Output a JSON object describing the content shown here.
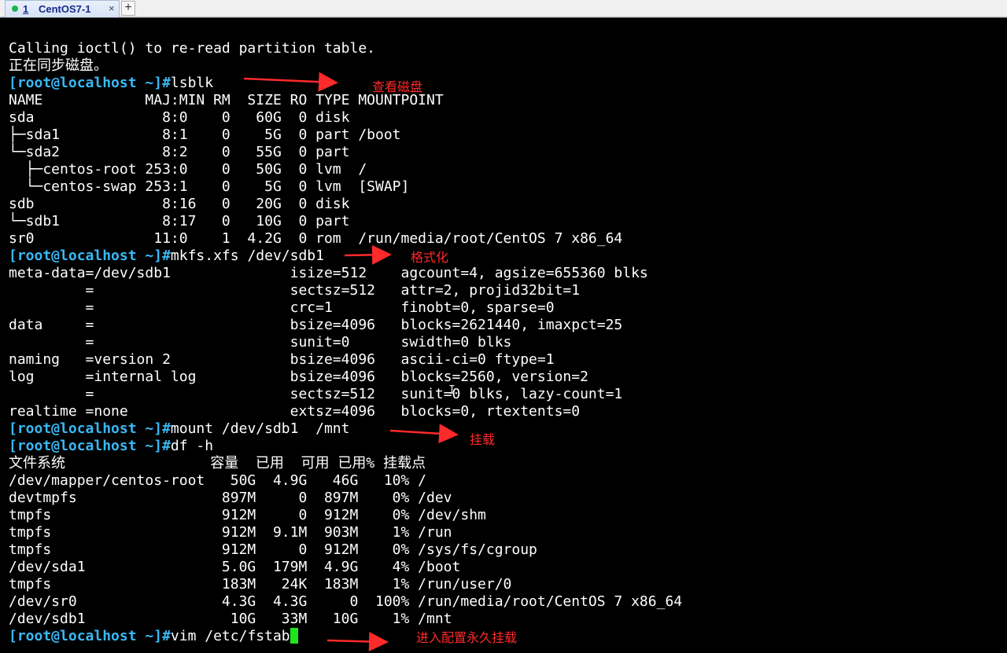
{
  "tab": {
    "number": "1",
    "title": "CentOS7-1",
    "close_glyph": "×",
    "add_glyph": "+"
  },
  "terminal": {
    "prompt": "[root@localhost ~]#",
    "lines": [
      {
        "type": "output",
        "text": "Calling ioctl() to re-read partition table."
      },
      {
        "type": "output",
        "text": "正在同步磁盘。"
      },
      {
        "type": "prompt",
        "cmd": "lsblk"
      },
      {
        "type": "output",
        "text": "NAME            MAJ:MIN RM  SIZE RO TYPE MOUNTPOINT"
      },
      {
        "type": "output",
        "text": "sda               8:0    0   60G  0 disk"
      },
      {
        "type": "output",
        "text": "├─sda1            8:1    0    5G  0 part /boot"
      },
      {
        "type": "output",
        "text": "└─sda2            8:2    0   55G  0 part"
      },
      {
        "type": "output",
        "text": "  ├─centos-root 253:0    0   50G  0 lvm  /"
      },
      {
        "type": "output",
        "text": "  └─centos-swap 253:1    0    5G  0 lvm  [SWAP]"
      },
      {
        "type": "output",
        "text": "sdb               8:16   0   20G  0 disk"
      },
      {
        "type": "output",
        "text": "└─sdb1            8:17   0   10G  0 part"
      },
      {
        "type": "output",
        "text": "sr0              11:0    1  4.2G  0 rom  /run/media/root/CentOS 7 x86_64"
      },
      {
        "type": "prompt",
        "cmd": "mkfs.xfs /dev/sdb1"
      },
      {
        "type": "output",
        "text": "meta-data=/dev/sdb1              isize=512    agcount=4, agsize=655360 blks"
      },
      {
        "type": "output",
        "text": "         =                       sectsz=512   attr=2, projid32bit=1"
      },
      {
        "type": "output",
        "text": "         =                       crc=1        finobt=0, sparse=0"
      },
      {
        "type": "output",
        "text": "data     =                       bsize=4096   blocks=2621440, imaxpct=25"
      },
      {
        "type": "output",
        "text": "         =                       sunit=0      swidth=0 blks"
      },
      {
        "type": "output",
        "text": "naming   =version 2              bsize=4096   ascii-ci=0 ftype=1"
      },
      {
        "type": "output",
        "text": "log      =internal log           bsize=4096   blocks=2560, version=2"
      },
      {
        "type": "output",
        "text": "         =                       sectsz=512   sunit=0 blks, lazy-count=1"
      },
      {
        "type": "output",
        "text": "realtime =none                   extsz=4096   blocks=0, rtextents=0"
      },
      {
        "type": "prompt",
        "cmd": "mount /dev/sdb1  /mnt"
      },
      {
        "type": "prompt",
        "cmd": "df -h"
      },
      {
        "type": "output",
        "text": "文件系统                 容量  已用  可用 已用% 挂载点"
      },
      {
        "type": "output",
        "text": "/dev/mapper/centos-root   50G  4.9G   46G   10% /"
      },
      {
        "type": "output",
        "text": "devtmpfs                 897M     0  897M    0% /dev"
      },
      {
        "type": "output",
        "text": "tmpfs                    912M     0  912M    0% /dev/shm"
      },
      {
        "type": "output",
        "text": "tmpfs                    912M  9.1M  903M    1% /run"
      },
      {
        "type": "output",
        "text": "tmpfs                    912M     0  912M    0% /sys/fs/cgroup"
      },
      {
        "type": "output",
        "text": "/dev/sda1                5.0G  179M  4.9G    4% /boot"
      },
      {
        "type": "output",
        "text": "tmpfs                    183M   24K  183M    1% /run/user/0"
      },
      {
        "type": "output",
        "text": "/dev/sr0                 4.3G  4.3G     0  100% /run/media/root/CentOS 7 x86_64"
      },
      {
        "type": "output",
        "text": "/dev/sdb1                 10G   33M   10G    1% /mnt"
      },
      {
        "type": "prompt",
        "cmd": "vim /etc/fstab",
        "cursor": true
      }
    ]
  },
  "annotations": [
    {
      "text": "查看磁盘"
    },
    {
      "text": "格式化"
    },
    {
      "text": "挂载"
    },
    {
      "text": "进入配置永久挂载"
    }
  ],
  "colors": {
    "background": "#000000",
    "text": "#ffffff",
    "prompt": "#39b8f4",
    "cursor": "#1ce61c",
    "annotation": "#ff2a2a"
  }
}
